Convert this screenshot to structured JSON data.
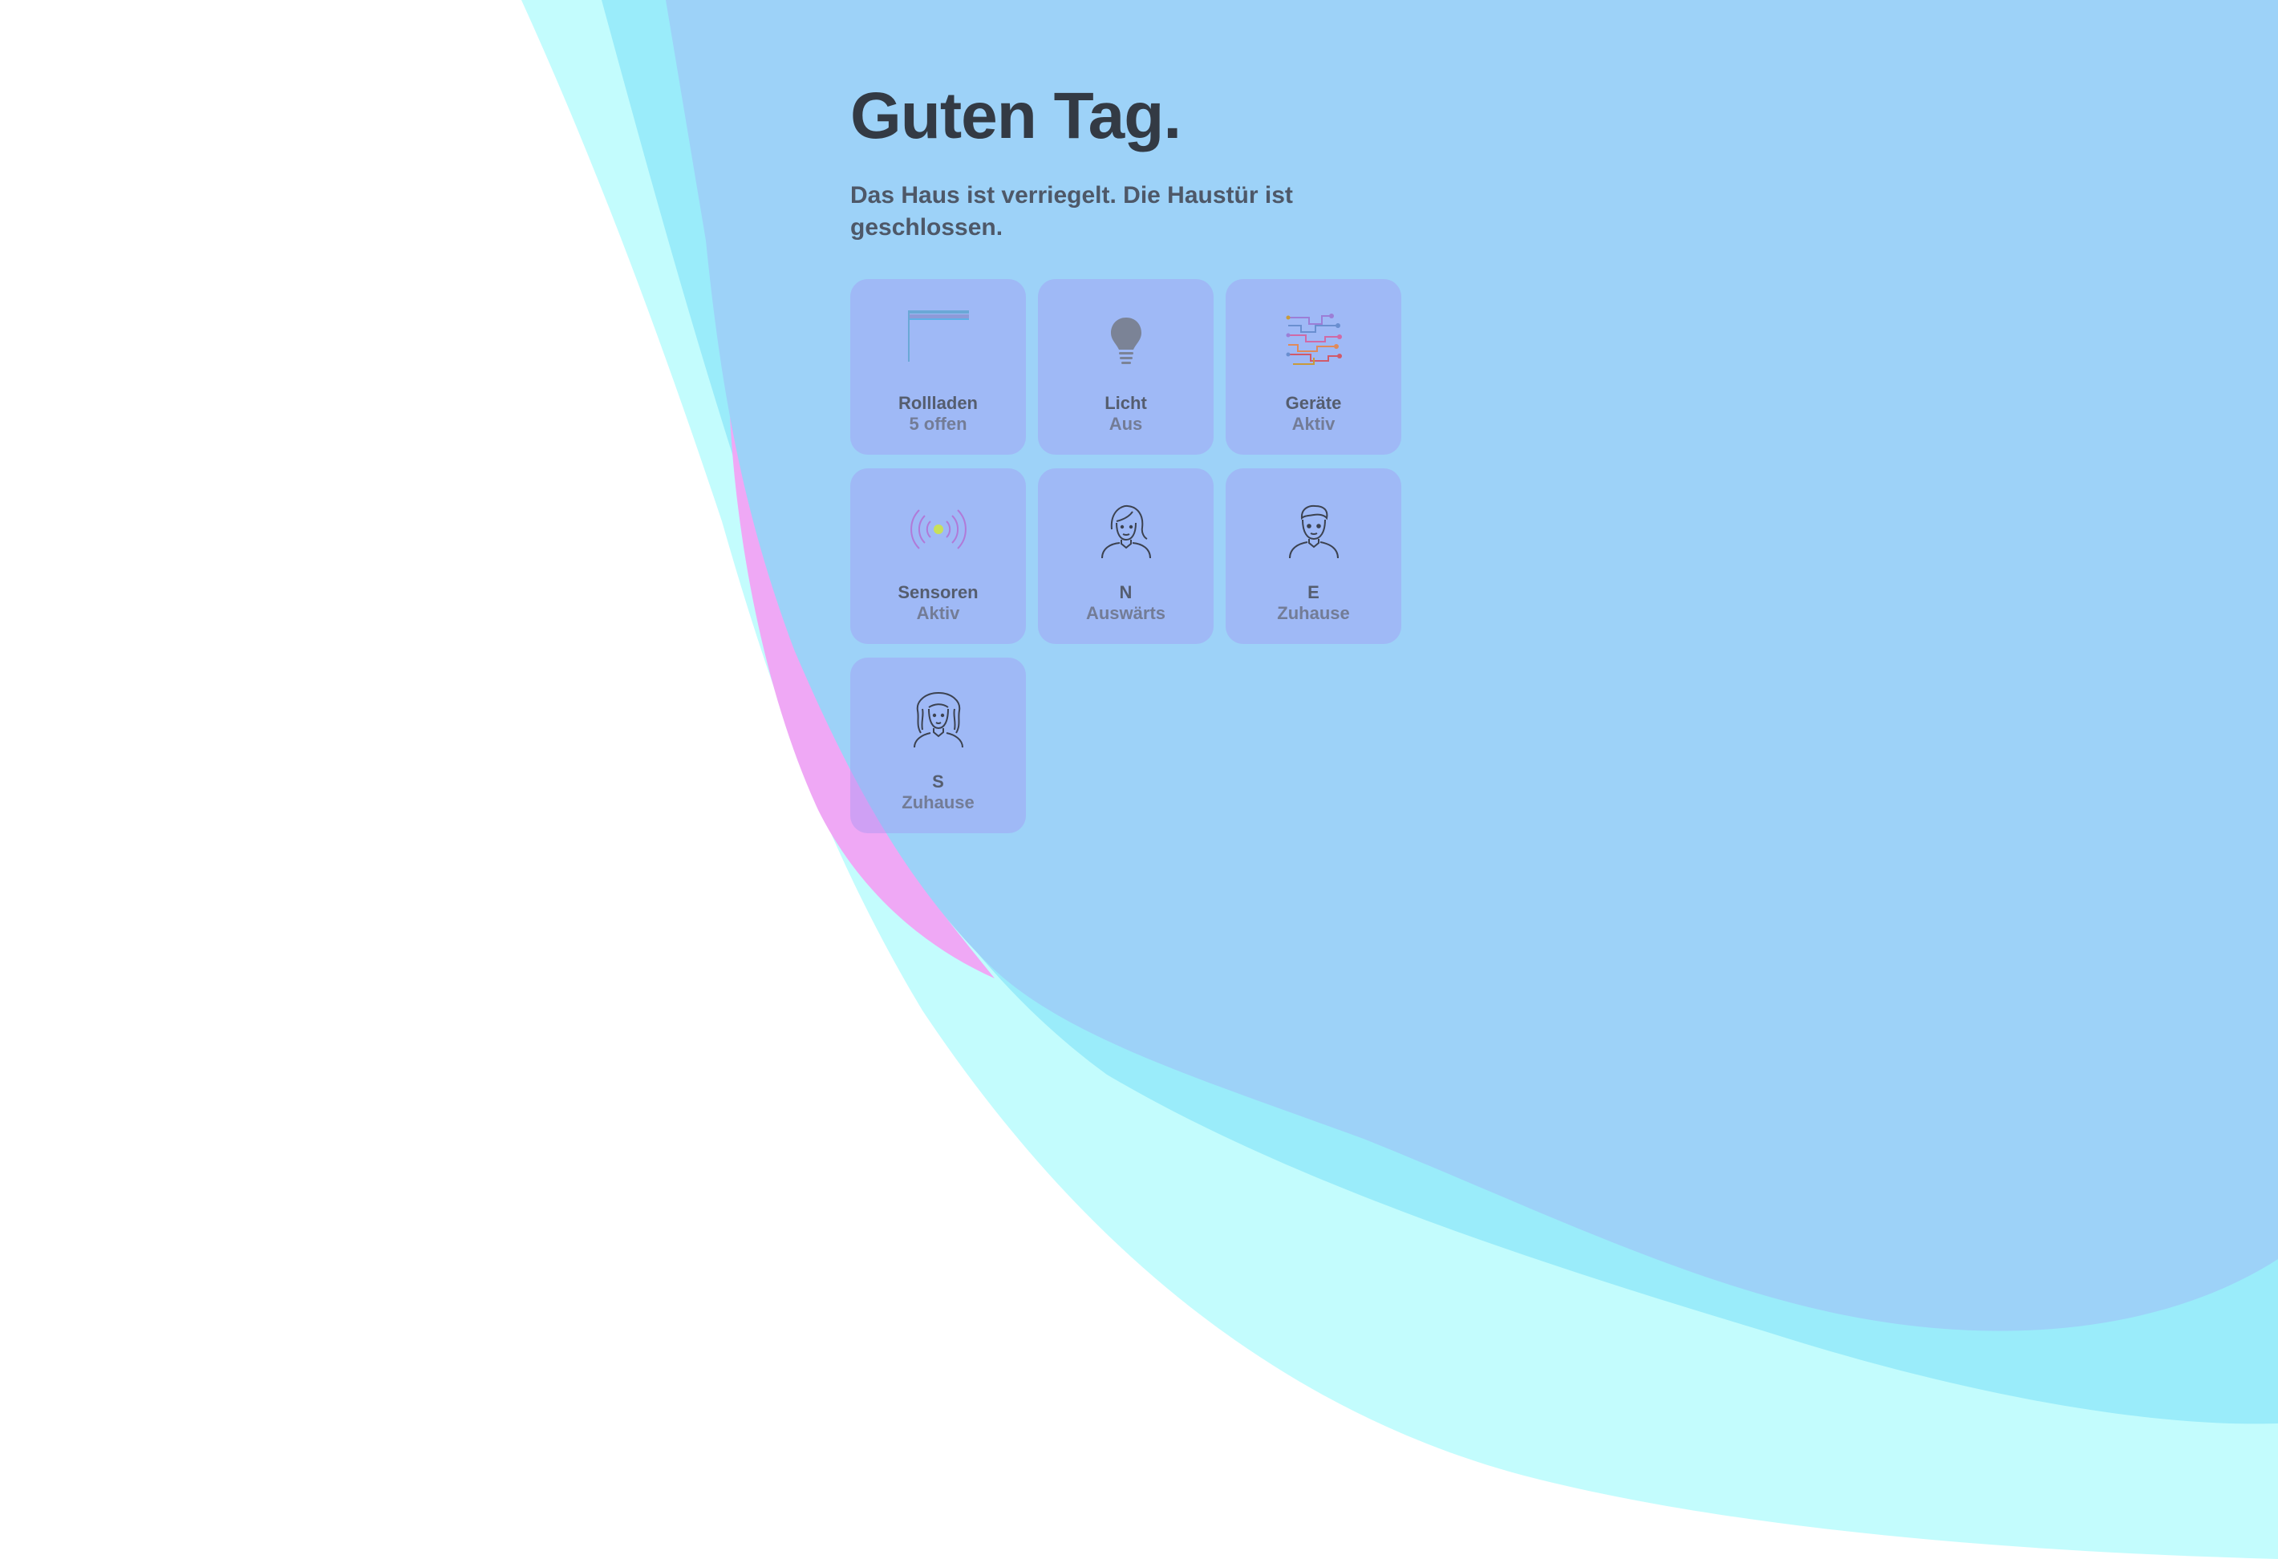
{
  "greeting": "Guten Tag.",
  "status": "Das Haus ist verriegelt. Die Haustür ist geschlossen.",
  "colors": {
    "wave_light": "#c3fcfd",
    "wave_mid": "#9aecfa",
    "wave_pink": "#efa8f5",
    "wave_blue": "#9dd2f8",
    "tile_background": "#a3adf4",
    "text_dark": "#333a44"
  },
  "tiles": [
    {
      "icon": "shutter-icon",
      "label": "Rollladen",
      "value": "5 offen"
    },
    {
      "icon": "lightbulb-icon",
      "label": "Licht",
      "value": "Aus"
    },
    {
      "icon": "circuit-icon",
      "label": "Geräte",
      "value": "Aktiv"
    },
    {
      "icon": "sensor-icon",
      "label": "Sensoren",
      "value": "Aktiv"
    },
    {
      "icon": "woman-avatar-icon",
      "label": "N",
      "value": "Auswärts"
    },
    {
      "icon": "man-avatar-icon",
      "label": "E",
      "value": "Zuhause"
    },
    {
      "icon": "curly-hair-avatar-icon",
      "label": "S",
      "value": "Zuhause"
    }
  ]
}
